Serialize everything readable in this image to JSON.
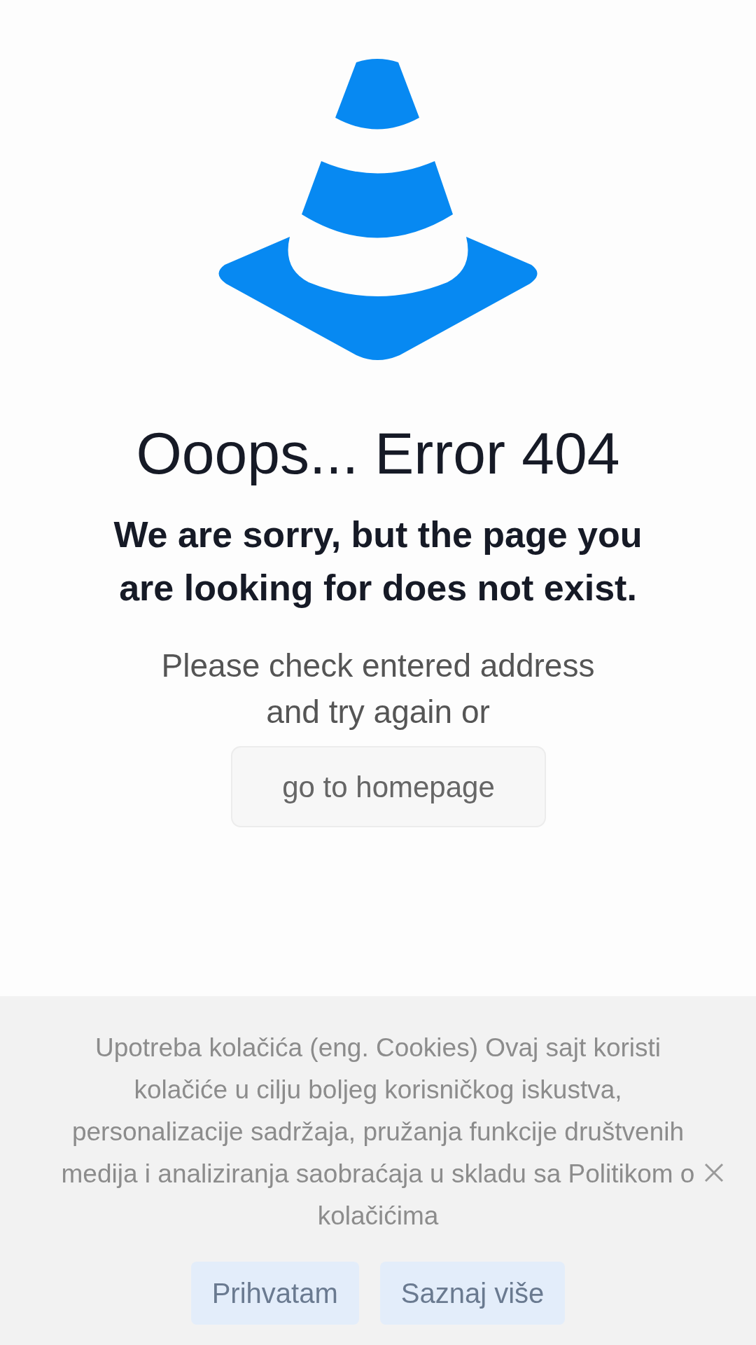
{
  "error_page": {
    "title": "Ooops... Error 404",
    "subtitle": "We are sorry, but the page you are looking for does not exist.",
    "message": "Please check entered address and try again or",
    "button": "go to homepage"
  },
  "cookie_banner": {
    "text": "Upotreba kolačića (eng. Cookies) Ovaj sajt koristi kolačiće u cilju boljeg korisničkog iskustva, personalizacije sadržaja, pružanja funkcije društvenih medija i analiziranja saobraćaja u skladu sa Politikom o kolačićima",
    "buttons": [
      "Prihvatam",
      "Saznaj više"
    ]
  }
}
